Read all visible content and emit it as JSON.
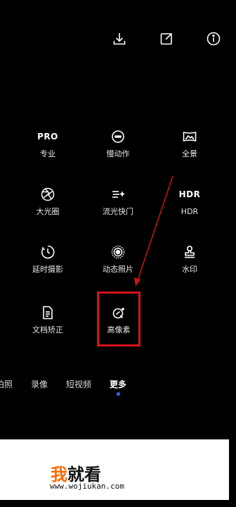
{
  "top_icons": [
    "download-icon",
    "edit-square-icon",
    "info-icon"
  ],
  "modes": [
    {
      "icon_text": "PRO",
      "label": "专业"
    },
    {
      "icon": "slowmo-icon",
      "label": "慢动作"
    },
    {
      "icon": "panorama-icon",
      "label": "全景"
    },
    {
      "icon": "aperture-icon",
      "label": "大光圈"
    },
    {
      "icon": "light-painting-icon",
      "label": "流光快门"
    },
    {
      "icon_text": "HDR",
      "label": "HDR"
    },
    {
      "icon": "timelapse-icon",
      "label": "延时摄影"
    },
    {
      "icon": "moving-picture-icon",
      "label": "动态照片"
    },
    {
      "icon": "stamp-icon",
      "label": "水印"
    },
    {
      "icon": "document-icon",
      "label": "文档矫正"
    },
    {
      "icon": "high-resolution-icon",
      "label": "高像素"
    }
  ],
  "tabs": [
    {
      "label": "拍照"
    },
    {
      "label": "录像"
    },
    {
      "label": "短视频"
    },
    {
      "label": "更多",
      "active": true
    }
  ],
  "watermark": {
    "accent": "我",
    "rest": "就看",
    "url": "www.wojiukan.com"
  },
  "colors": {
    "highlight": "#d2141b",
    "active_dot": "#2f6cf5",
    "watermark_accent": "#ff6a00"
  }
}
